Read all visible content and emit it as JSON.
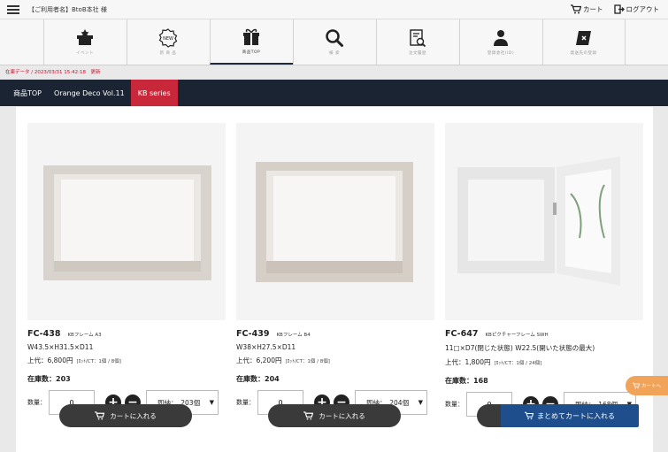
{
  "header": {
    "username": "【ご利用者名】BtoB本社 様",
    "cart_label": "カート",
    "logout_label": "ログアウト"
  },
  "nav": [
    {
      "label": "イベント",
      "icon": "event-icon"
    },
    {
      "label": "新 商 品",
      "icon": "new-badge-icon"
    },
    {
      "label": "商品TOP",
      "icon": "gift-box-icon",
      "active": true
    },
    {
      "label": "検 索",
      "icon": "search-icon"
    },
    {
      "label": "注文履歴",
      "icon": "order-history-icon"
    },
    {
      "label": "登録会社(ID)",
      "icon": "person-icon"
    },
    {
      "label": "発送先の登録",
      "icon": "shipping-address-icon"
    }
  ],
  "data_info": "在庫データ / 2023/03/31 15:42:18　更新",
  "breadcrumbs": [
    "商品TOP",
    "Orange Deco Vol.11",
    "KB series"
  ],
  "products": [
    {
      "code": "FC-438",
      "name": "KBフレーム A3",
      "size": "W43.5×H31.5×D11",
      "price": "上代：6,800円",
      "lot": "[ﾛｯﾄ/CT：1個 / 8個]",
      "stock": "在庫数：203",
      "qty_label": "数量：",
      "qty": "0",
      "ship": "即納：　203個"
    },
    {
      "code": "FC-439",
      "name": "KBフレーム B4",
      "size": "W38×H27.5×D11",
      "price": "上代：6,200円",
      "lot": "[ﾛｯﾄ/CT：1個 / 8個]",
      "stock": "在庫数：204",
      "qty_label": "数量：",
      "qty": "0",
      "ship": "即納：　204個"
    },
    {
      "code": "FC-647",
      "name": "KBピクチャーフレーム SWH",
      "size": "11□×D7(閉じた状態) W22.5(開いた状態の最大)",
      "price": "上代：1,800円",
      "lot": "[ﾛｯﾄ/CT：1個 / 24個]",
      "stock": "在庫数：168",
      "qty_label": "数量：",
      "qty": "0",
      "ship": "即納：　168個"
    }
  ],
  "add_to_cart_label": "カートに入れる",
  "bulk_add_label": "まとめてカートに入れる",
  "float_cart_label": "カートへ",
  "colors": {
    "nav_dark": "#1b2433",
    "accent_red": "#c9283a",
    "bulk_blue": "#1e4f8c",
    "float_orange": "#f2a35a"
  }
}
